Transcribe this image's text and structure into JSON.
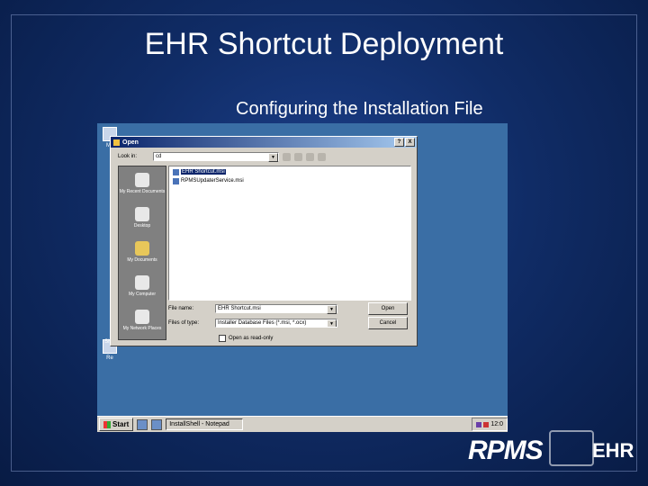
{
  "slide": {
    "title": "EHR Shortcut Deployment",
    "subtitle": "Configuring the Installation File"
  },
  "desktop": {
    "icons": [
      "My",
      "",
      "",
      "",
      "",
      "",
      "Re",
      "Sha_S.ms"
    ]
  },
  "dialog": {
    "title": "Open",
    "title_buttons": [
      "?",
      "X"
    ],
    "look_in_label": "Look in:",
    "look_in_value": "cd",
    "places": [
      "My Recent Documents",
      "Desktop",
      "My Documents",
      "My Computer",
      "My Network Places"
    ],
    "files": [
      {
        "name": "EHR Shortcut.msi",
        "selected": true
      },
      {
        "name": "RPMSUpdaterService.msi",
        "selected": false
      }
    ],
    "file_name_label": "File name:",
    "file_name_value": "EHR Shortcut.msi",
    "file_type_label": "Files of type:",
    "file_type_value": "Installer Database Files (*.msi, *.ocx)",
    "open_button": "Open",
    "cancel_button": "Cancel",
    "readonly_label": "Open as read-only"
  },
  "taskbar": {
    "start_label": "Start",
    "task_label": "InstallShell - Notepad",
    "clock": "12:0"
  },
  "logo": {
    "rpms": "RPMS",
    "ehr": "EHR"
  }
}
